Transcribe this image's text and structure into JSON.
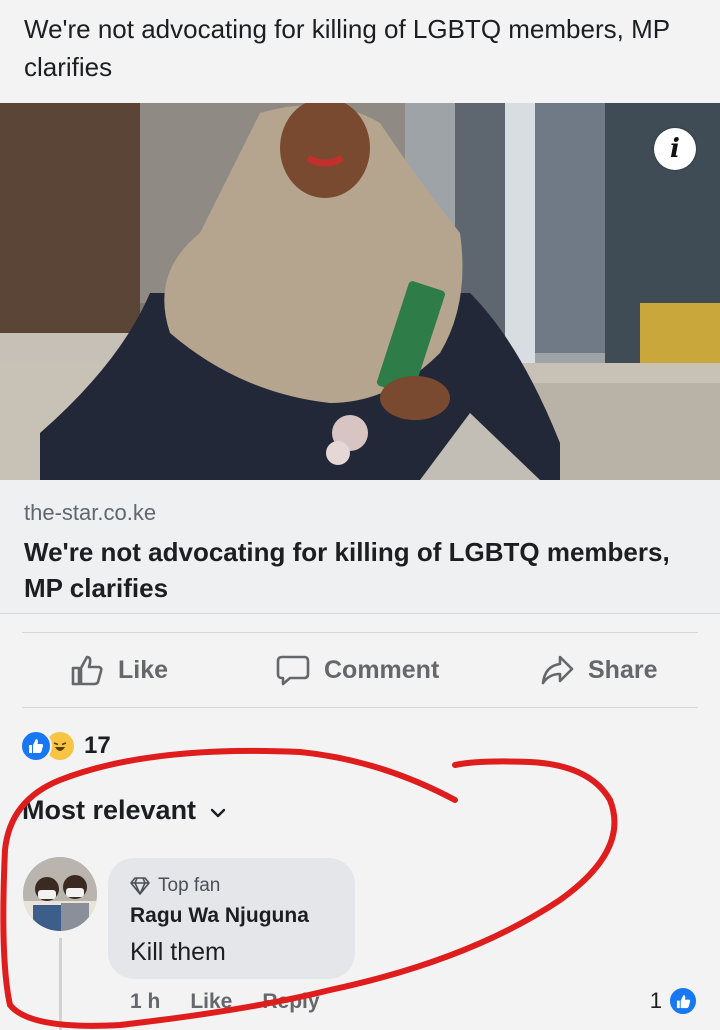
{
  "post": {
    "text": "We're not advocating for killing of LGBTQ members, MP clarifies"
  },
  "link_preview": {
    "domain": "the-star.co.ke",
    "title": "We're not advocating for killing of LGBTQ members, MP clarifies",
    "info_icon": "i"
  },
  "actions": {
    "like_label": "Like",
    "comment_label": "Comment",
    "share_label": "Share"
  },
  "reactions": {
    "types": [
      "like-icon",
      "haha-icon"
    ],
    "count": "17"
  },
  "comments_sort": {
    "label": "Most relevant"
  },
  "comment": {
    "badge": "Top fan",
    "author": "Ragu Wa Njuguna",
    "text": "Kill them",
    "time": "1 h",
    "like_label": "Like",
    "reply_label": "Reply",
    "like_count": "1"
  },
  "colors": {
    "background": "#f3f3f4",
    "accent_blue": "#1877f2",
    "annotation_red": "#e01d1d",
    "muted_text": "#65676b"
  }
}
